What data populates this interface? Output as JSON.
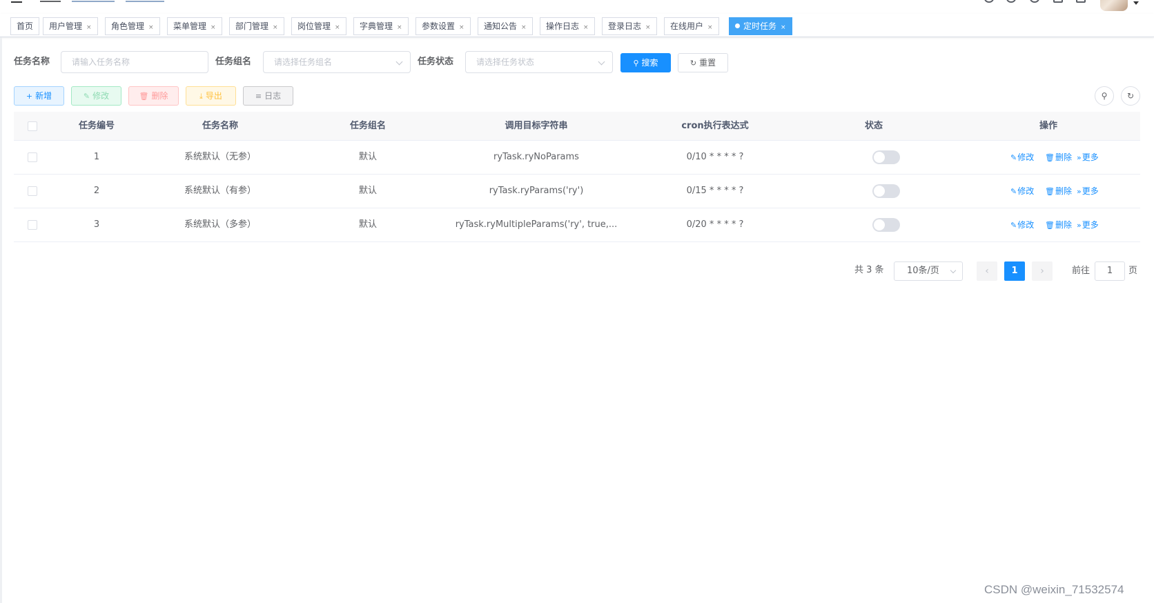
{
  "tags": [
    {
      "label": "首页",
      "closable": false,
      "active": false
    },
    {
      "label": "用户管理",
      "closable": true,
      "active": false
    },
    {
      "label": "角色管理",
      "closable": true,
      "active": false
    },
    {
      "label": "菜单管理",
      "closable": true,
      "active": false
    },
    {
      "label": "部门管理",
      "closable": true,
      "active": false
    },
    {
      "label": "岗位管理",
      "closable": true,
      "active": false
    },
    {
      "label": "字典管理",
      "closable": true,
      "active": false
    },
    {
      "label": "参数设置",
      "closable": true,
      "active": false
    },
    {
      "label": "通知公告",
      "closable": true,
      "active": false
    },
    {
      "label": "操作日志",
      "closable": true,
      "active": false
    },
    {
      "label": "登录日志",
      "closable": true,
      "active": false
    },
    {
      "label": "在线用户",
      "closable": true,
      "active": false
    },
    {
      "label": "定时任务",
      "closable": true,
      "active": true
    }
  ],
  "tag_close_glyph": "×",
  "search": {
    "job_name_label": "任务名称",
    "job_name_placeholder": "请输入任务名称",
    "job_group_label": "任务组名",
    "job_group_placeholder": "请选择任务组名",
    "status_label": "任务状态",
    "status_placeholder": "请选择任务状态",
    "search_button": "搜索",
    "reset_button": "重置"
  },
  "toolbar": {
    "add": "新增",
    "edit": "修改",
    "delete": "删除",
    "export": "导出",
    "log": "日志"
  },
  "table": {
    "columns": [
      "任务编号",
      "任务名称",
      "任务组名",
      "调用目标字符串",
      "cron执行表达式",
      "状态",
      "操作"
    ],
    "rows": [
      {
        "id": "1",
        "name": "系统默认（无参）",
        "group": "默认",
        "target": "ryTask.ryNoParams",
        "cron": "0/10 * * * * ?",
        "enabled": false
      },
      {
        "id": "2",
        "name": "系统默认（有参）",
        "group": "默认",
        "target": "ryTask.ryParams('ry')",
        "cron": "0/15 * * * * ?",
        "enabled": false
      },
      {
        "id": "3",
        "name": "系统默认（多参）",
        "group": "默认",
        "target": "ryTask.ryMultipleParams('ry', true,...",
        "cron": "0/20 * * * * ?",
        "enabled": false
      }
    ],
    "row_actions": {
      "edit": "修改",
      "delete": "删除",
      "more": "更多"
    }
  },
  "pagination": {
    "total_text": "共 3 条",
    "page_size": "10条/页",
    "current_page": "1",
    "goto_label": "前往",
    "goto_value": "1",
    "page_suffix": "页"
  },
  "watermark": "CSDN @weixin_71532574",
  "colors": {
    "primary": "#1890ff",
    "active_tag": "#42a5f6"
  }
}
